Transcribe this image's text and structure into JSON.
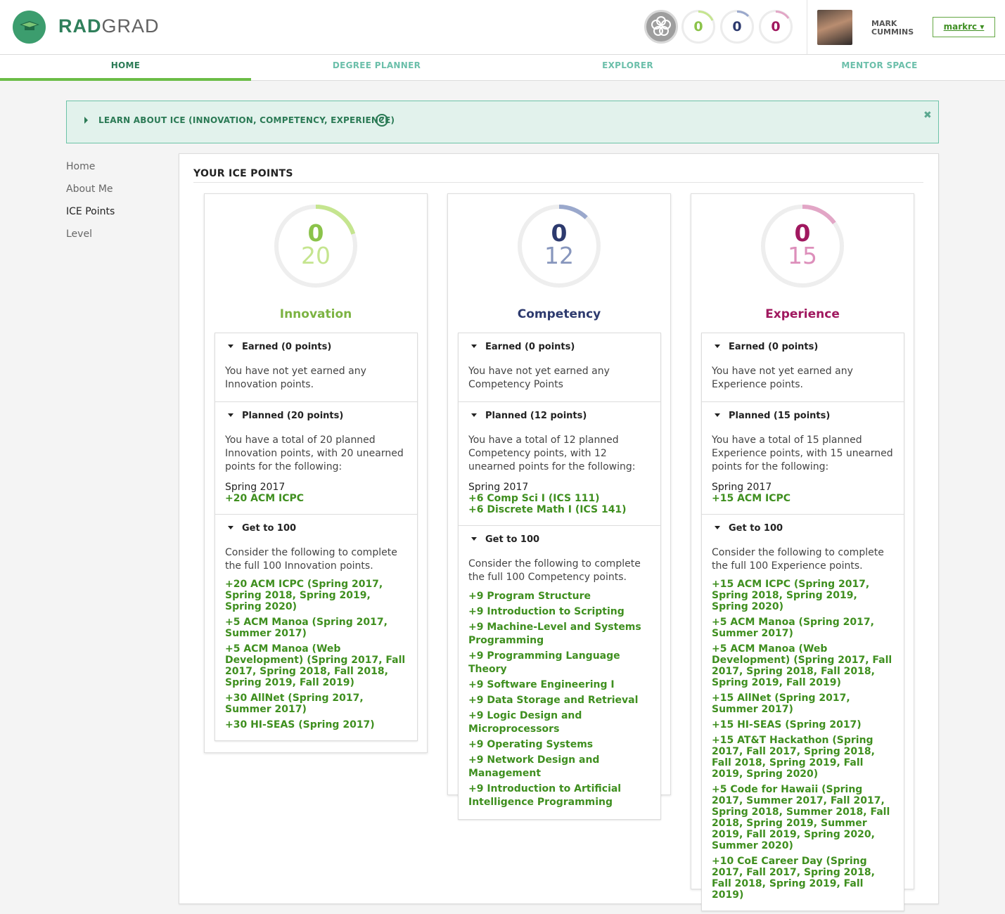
{
  "brand": {
    "rad": "RAD",
    "grad": "GRAD"
  },
  "header": {
    "innovation_count": "0",
    "competency_count": "0",
    "experience_count": "0",
    "user_name_line1": "MARK",
    "user_name_line2": "CUMMINS",
    "user_menu_label": "markrc ▾"
  },
  "nav": {
    "home": "HOME",
    "degree_planner": "DEGREE PLANNER",
    "explorer": "EXPLORER",
    "mentor_space": "MENTOR SPACE"
  },
  "banner": {
    "text": "LEARN ABOUT ICE (INNOVATION, COMPETENCY, EXPERIENCE)",
    "help": "?",
    "close": "✖"
  },
  "sidebar": {
    "items": [
      "Home",
      "About Me",
      "ICE Points",
      "Level"
    ],
    "active": "ICE Points"
  },
  "main": {
    "title": "YOUR ICE POINTS"
  },
  "colors": {
    "innovation": "#8bc34a",
    "competency": "#2d3a6e",
    "experience": "#a0185f",
    "link_green": "#3f8f1f"
  },
  "innovation": {
    "earned_value": "0",
    "planned_value": "20",
    "title": "Innovation",
    "earned_head": "Earned (0 points)",
    "earned_text": "You have not yet earned any Innovation points.",
    "planned_head": "Planned (20 points)",
    "planned_text": "You have a total of 20 planned Innovation points, with 20 unearned points for the following:",
    "planned_term": "Spring 2017",
    "planned_items": [
      "+20 ACM ICPC"
    ],
    "get_head": "Get to 100",
    "get_text": "Consider the following to complete the full 100 Innovation points.",
    "get_items": [
      "+20 ACM ICPC (Spring 2017, Spring 2018, Spring 2019, Spring 2020)",
      "+5 ACM Manoa (Spring 2017, Summer 2017)",
      "+5 ACM Manoa (Web Development) (Spring 2017, Fall 2017, Spring 2018, Fall 2018, Spring 2019, Fall 2019)",
      "+30 AllNet (Spring 2017, Summer 2017)",
      "+30 HI-SEAS (Spring 2017)"
    ]
  },
  "competency": {
    "earned_value": "0",
    "planned_value": "12",
    "title": "Competency",
    "earned_head": "Earned (0 points)",
    "earned_text": "You have not yet earned any Competency Points",
    "planned_head": "Planned (12 points)",
    "planned_text": "You have a total of 12 planned Competency points, with 12 unearned points for the following:",
    "planned_term": "Spring 2017",
    "planned_items": [
      "+6 Comp Sci I (ICS 111)",
      "+6 Discrete Math I (ICS 141)"
    ],
    "get_head": "Get to 100",
    "get_text": "Consider the following to complete the full 100 Competency points.",
    "get_items": [
      "+9 Program Structure",
      "+9 Introduction to Scripting",
      "+9 Machine-Level and Systems Programming",
      "+9 Programming Language Theory",
      "+9 Software Engineering I",
      "+9 Data Storage and Retrieval",
      "+9 Logic Design and Microprocessors",
      "+9 Operating Systems",
      "+9 Network Design and Management",
      "+9 Introduction to Artificial Intelligence Programming"
    ]
  },
  "experience": {
    "earned_value": "0",
    "planned_value": "15",
    "title": "Experience",
    "earned_head": "Earned (0 points)",
    "earned_text": "You have not yet earned any Experience points.",
    "planned_head": "Planned (15 points)",
    "planned_text": "You have a total of 15 planned Experience points, with 15 unearned points for the following:",
    "planned_term": "Spring 2017",
    "planned_items": [
      "+15 ACM ICPC"
    ],
    "get_head": "Get to 100",
    "get_text": "Consider the following to complete the full 100 Experience points.",
    "get_items": [
      "+15 ACM ICPC (Spring 2017, Spring 2018, Spring 2019, Spring 2020)",
      "+5 ACM Manoa (Spring 2017, Summer 2017)",
      "+5 ACM Manoa (Web Development) (Spring 2017, Fall 2017, Spring 2018, Fall 2018, Spring 2019, Fall 2019)",
      "+15 AllNet (Spring 2017, Summer 2017)",
      "+15 HI-SEAS (Spring 2017)",
      "+15 AT&T Hackathon (Spring 2017, Fall 2017, Spring 2018, Fall 2018, Spring 2019, Fall 2019, Spring 2020)",
      "+5 Code for Hawaii (Spring 2017, Summer 2017, Fall 2017, Spring 2018, Summer 2018, Fall 2018, Spring 2019, Summer 2019, Fall 2019, Spring 2020, Summer 2020)",
      "+10 CoE Career Day (Spring 2017, Fall 2017, Spring 2018, Fall 2018, Spring 2019, Fall 2019)"
    ]
  }
}
